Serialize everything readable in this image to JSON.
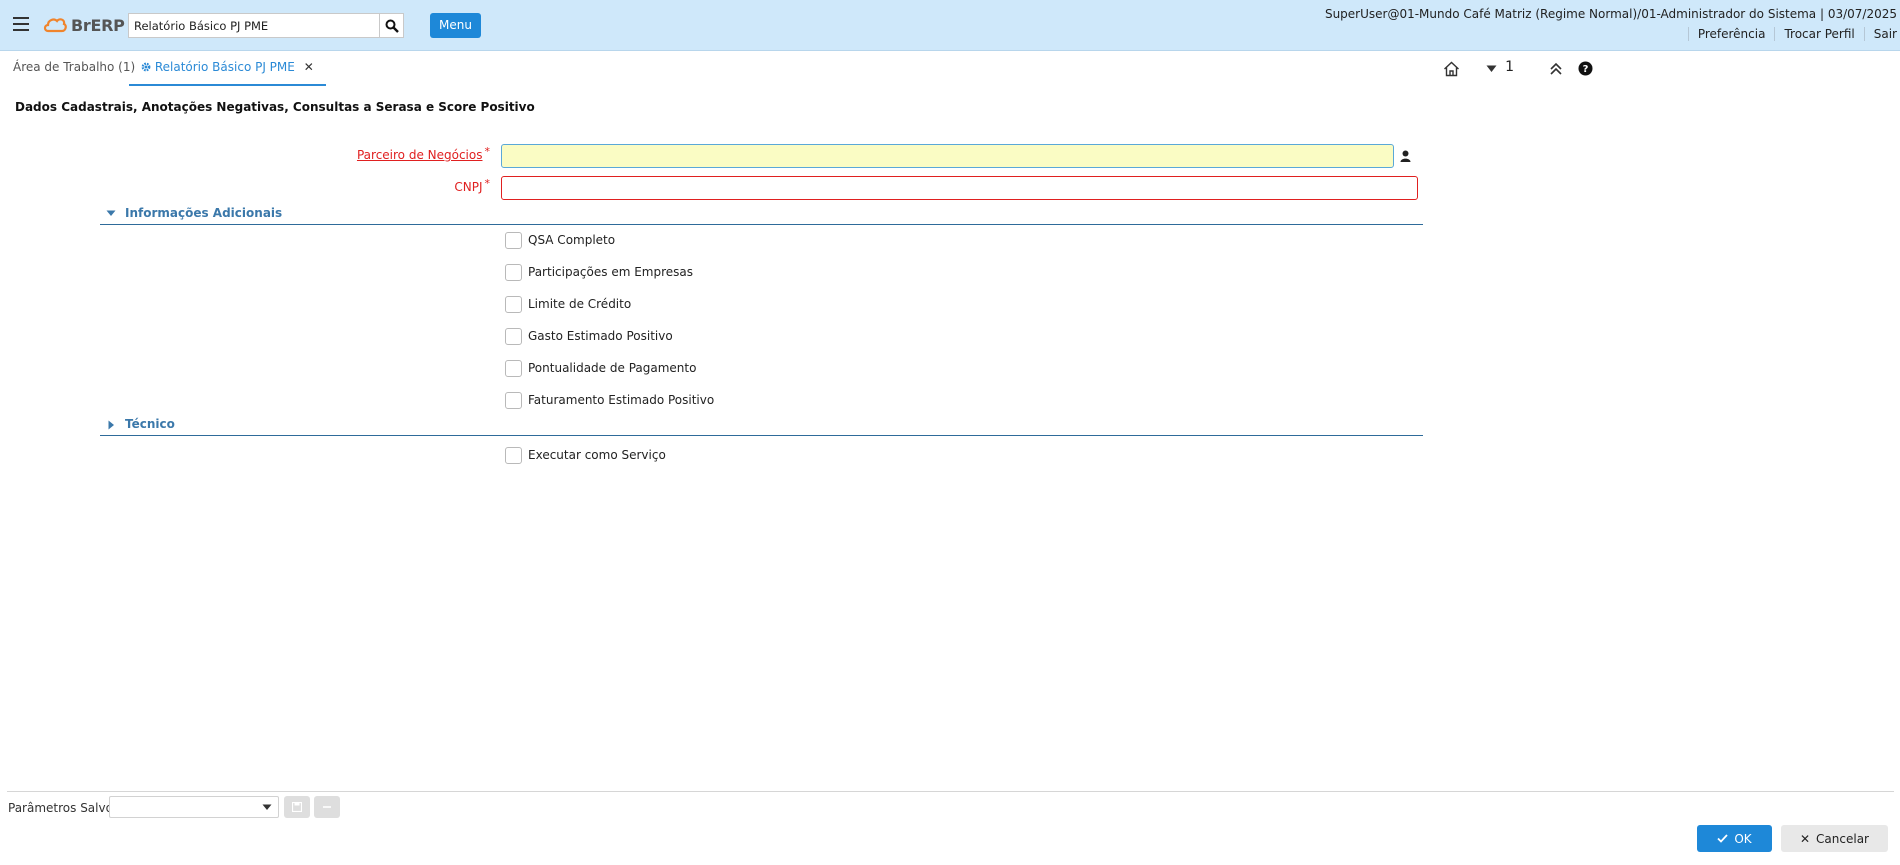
{
  "header": {
    "brand": "BrERP",
    "search_value": "Relatório Básico PJ PME",
    "menu_label": "Menu",
    "user_info": "SuperUser@01-Mundo Café Matriz (Regime Normal)/01-Administrador do Sistema | 03/07/2025",
    "links": [
      "Preferência",
      "Trocar Perfil",
      "Sair"
    ]
  },
  "tabs": [
    {
      "label": "Área de Trabalho (1)"
    },
    {
      "label": "Relatório Básico PJ PME"
    }
  ],
  "toolbar": {
    "counter": "1"
  },
  "main": {
    "title": "Dados Cadastrais, Anotações Negativas, Consultas a Serasa e Score Positivo",
    "fields": [
      {
        "label": "Parceiro de Negócios",
        "required": "*",
        "value": ""
      },
      {
        "label": "CNPJ",
        "required": "*",
        "value": ""
      }
    ],
    "groups": [
      {
        "title": "Informações Adicionais",
        "expanded": true,
        "checkboxes": [
          {
            "label": "QSA Completo",
            "checked": false
          },
          {
            "label": "Participações em Empresas",
            "checked": false
          },
          {
            "label": "Limite de Crédito",
            "checked": false
          },
          {
            "label": "Gasto Estimado Positivo",
            "checked": false
          },
          {
            "label": "Pontualidade de Pagamento",
            "checked": false
          },
          {
            "label": "Faturamento Estimado Positivo",
            "checked": false
          }
        ]
      },
      {
        "title": "Técnico",
        "expanded": false,
        "checkboxes": [
          {
            "label": "Executar como Serviço",
            "checked": false
          }
        ]
      }
    ]
  },
  "footer": {
    "saved_params_label": "Parâmetros Salvos",
    "saved_params_value": "",
    "ok_label": "OK",
    "cancel_label": "Cancelar"
  },
  "colors": {
    "header_bg": "#cfe8fa",
    "accent": "#1e88d8",
    "required": "#e02020",
    "focused_field_bg": "#fafcc4",
    "group_title": "#3b78aa"
  },
  "icons": [
    "hamburger-icon",
    "brand-logo-icon",
    "search-icon",
    "gear-icon",
    "close-icon",
    "home-icon",
    "caret-down-icon",
    "chevrons-up-icon",
    "help-icon",
    "business-partner-icon",
    "save-icon",
    "minus-icon",
    "check-icon"
  ]
}
